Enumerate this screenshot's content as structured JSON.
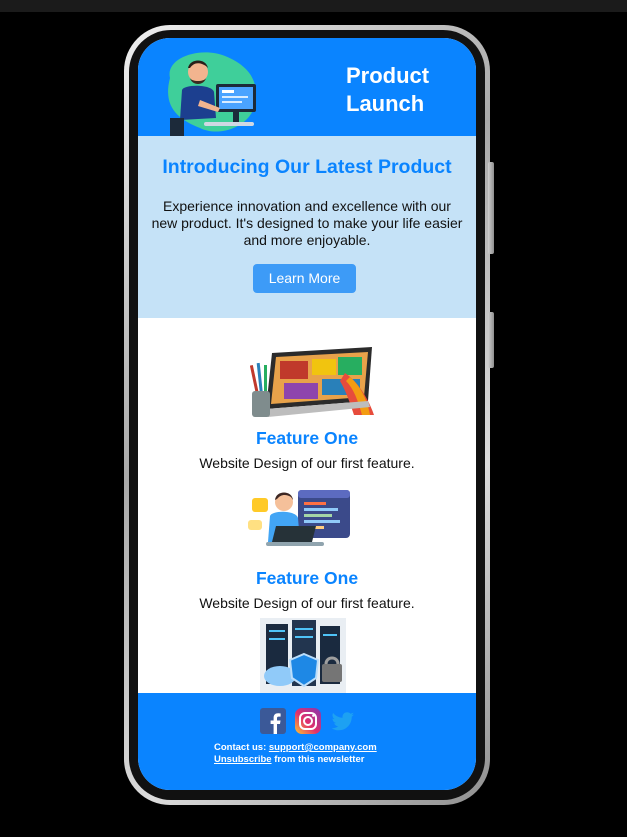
{
  "header": {
    "title": "Product Launch"
  },
  "hero": {
    "title": "Introducing Our Latest Product",
    "text": "Experience innovation and excellence with our new product. It's designed to make your life easier and more enjoyable.",
    "cta_label": "Learn More"
  },
  "features": [
    {
      "title": "Feature One",
      "desc": "Website Design of our first feature."
    },
    {
      "title": "Feature One",
      "desc": "Website Design of our first feature."
    }
  ],
  "footer": {
    "contact_prefix": "Contact us:",
    "contact_email": "support@company.com",
    "unsubscribe_label": "Unsubscribe",
    "unsubscribe_suffix": "from this newsletter"
  },
  "social_icons": [
    "facebook-icon",
    "instagram-icon",
    "twitter-icon"
  ],
  "colors": {
    "accent": "#0a84ff",
    "hero_bg": "#c5e2f7",
    "button": "#3d9bf7"
  }
}
